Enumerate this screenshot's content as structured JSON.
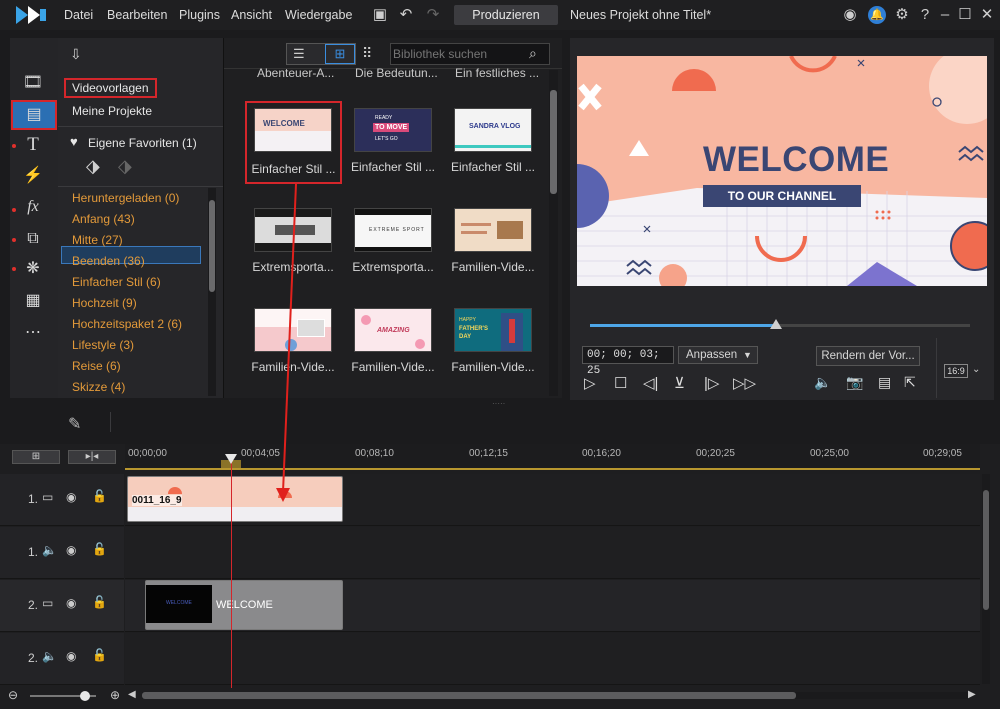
{
  "menubar": {
    "items": [
      "Datei",
      "Bearbeiten",
      "Plugins",
      "Ansicht",
      "Wiedergabe"
    ],
    "produce_label": "Produzieren",
    "project_title": "Neues Projekt ohne Titel*"
  },
  "library": {
    "search_placeholder": "Bibliothek suchen",
    "tab_templates": "Videovorlagen",
    "tab_projects": "Meine Projekte",
    "favorites_label": "Eigene Favoriten (1)",
    "categories": [
      "Heruntergeladen  (0)",
      "Anfang  (43)",
      "Mitte  (27)",
      "Beenden  (36)",
      "Einfacher Stil  (6)",
      "Hochzeit  (9)",
      "Hochzeitspaket 2  (6)",
      "Lifestyle  (3)",
      "Reise  (6)",
      "Skizze  (4)"
    ],
    "top_row_labels": [
      "Abenteuer-A...",
      "Die Bedeutun...",
      "Ein festliches ..."
    ],
    "templates": [
      {
        "label": "Einfacher Stil ...",
        "text": "WELCOME",
        "bg": "#f6d3c8"
      },
      {
        "label": "Einfacher Stil ...",
        "text": "TO MOVE",
        "bg": "#2c2f5a"
      },
      {
        "label": "Einfacher Stil ...",
        "text": "SANDRA VLOG",
        "bg": "#f3f3f3"
      },
      {
        "label": "Extremsporta...",
        "text": "",
        "bg": "#dcdcdc"
      },
      {
        "label": "Extremsporta...",
        "text": "EXTREME SPORT",
        "bg": "#f6f6f6"
      },
      {
        "label": "Familien-Vide...",
        "text": "",
        "bg": "#f0dcc6"
      },
      {
        "label": "Familien-Vide...",
        "text": "",
        "bg": "#f5c9cc"
      },
      {
        "label": "Familien-Vide...",
        "text": "AMAZING",
        "bg": "#fbe8ec"
      },
      {
        "label": "Familien-Vide...",
        "text": "FATHER'S DAY",
        "bg": "#0f6c7e"
      }
    ],
    "thumb_small_texts": [
      "READY",
      "LET'S GO",
      "HAPPY"
    ]
  },
  "preview": {
    "title": "WELCOME",
    "subtitle": "TO OUR CHANNEL",
    "timecode": "00; 00; 03; 25",
    "fit_label": "Anpassen",
    "render_label": "Rendern der Vor...",
    "aspect_label": "16:9",
    "progress": 0.49
  },
  "timeline": {
    "ticks": [
      "00;00;00",
      "00;04;05",
      "00;08;10",
      "00;12;15",
      "00;16;20",
      "00;20;25",
      "00;25;00",
      "00;29;05"
    ],
    "track_numbers": [
      "1.",
      "1.",
      "2.",
      "2."
    ],
    "clip1_label": "0011_16_9",
    "clip2_label": "WELCOME",
    "clip2_thumb_text": "WELCOME"
  },
  "colors": {
    "accent_red": "#d4262b",
    "accent_blue": "#2b6fb3",
    "category_orange": "#e39a3a",
    "welcome_navy": "#3a4673"
  }
}
